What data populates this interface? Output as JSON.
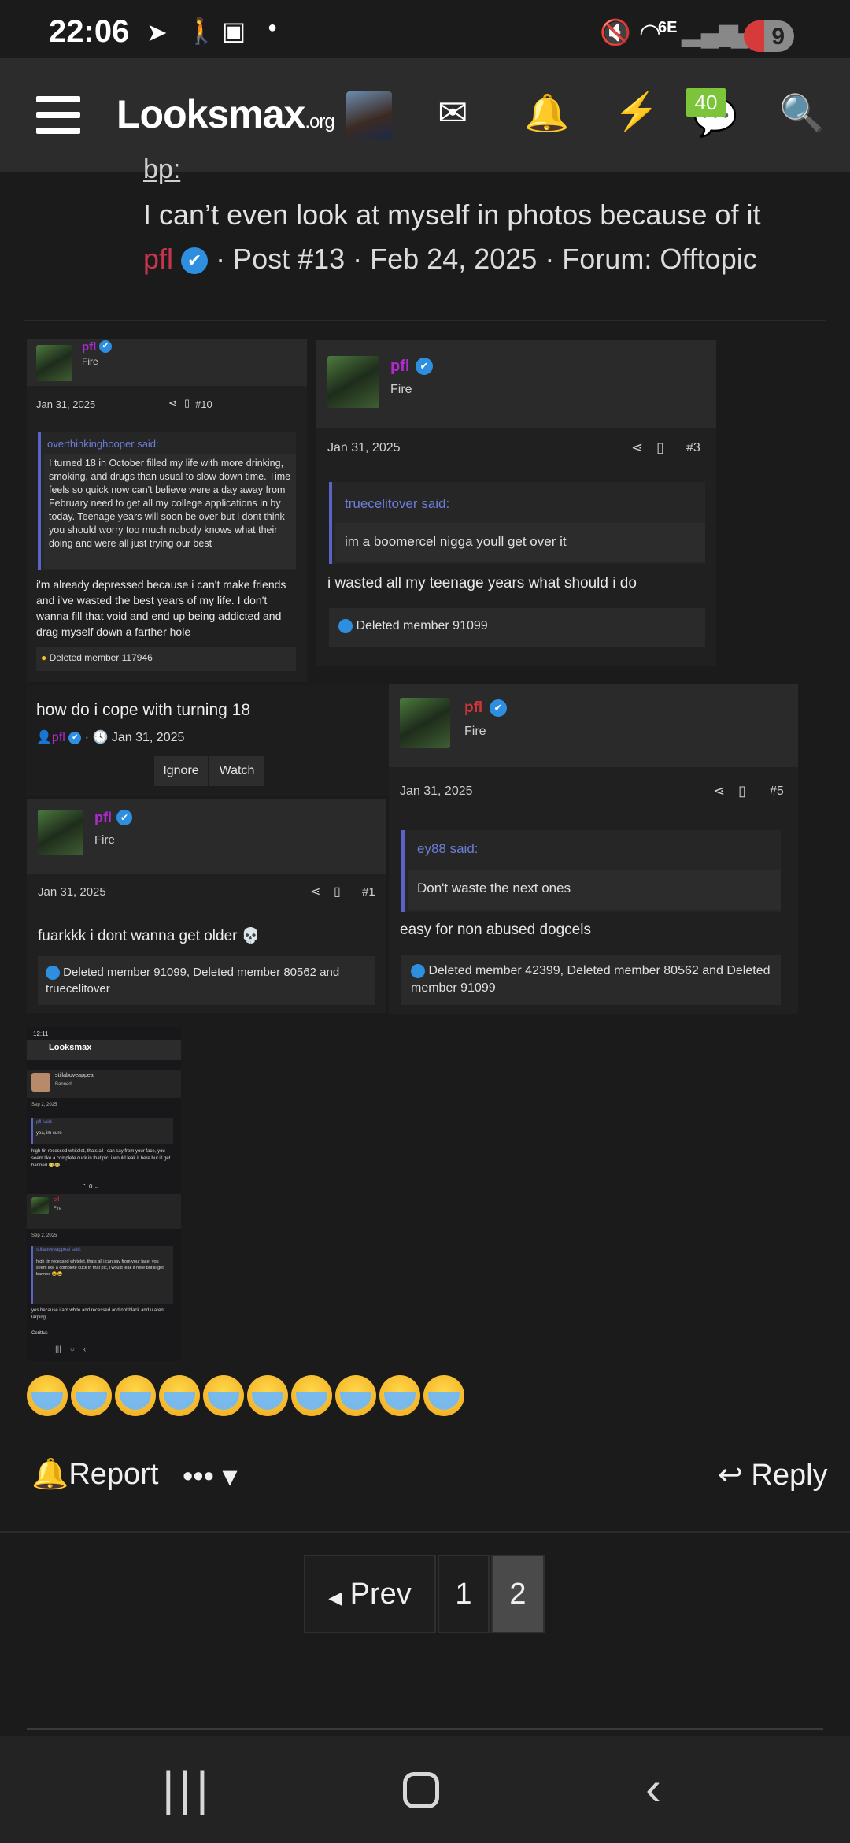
{
  "status": {
    "time": "22:06",
    "network": "6E",
    "battery": "9"
  },
  "nav": {
    "logo_main": "Looksmax",
    "logo_suffix": ".org",
    "badge_count": "40"
  },
  "post": {
    "bp_text": "bp:",
    "title": "I can’t even look at myself in photos because of it",
    "author": "pfl",
    "meta": "· Post #13 · Feb 24, 2025 · Forum: Offtopic"
  },
  "card_a": {
    "user": "pfl",
    "rank": "Fire",
    "date": "Jan 31, 2025",
    "post_no": "#10",
    "quote_author": "overthinkinghooper said:",
    "quote_body": "I turned 18 in October filled my life with more drinking, smoking, and drugs than usual to slow down time. Time feels so quick now can't believe were a day away from February need to get all my college applications in by today. Teenage years will soon be over but i dont think you should worry too much nobody knows what their doing and were all just trying our best",
    "reply": "i'm already depressed because i can't make friends and i've wasted the best years of my life. I don't wanna fill that void and end up being addicted and drag myself down a farther hole",
    "reactions": "Deleted member 117946"
  },
  "card_b": {
    "user": "pfl",
    "rank": "Fire",
    "date": "Jan 31, 2025",
    "post_no": "#3",
    "quote_author": "truecelitover said:",
    "quote_body": "im a boomercel nigga youll get over it",
    "reply": "i wasted all my teenage years what should i do",
    "reactions": "Deleted member 91099"
  },
  "thread": {
    "title": "how do i cope with turning 18",
    "author": "pfl",
    "date": "Jan 31, 2025",
    "ignore": "Ignore",
    "watch": "Watch"
  },
  "card_c": {
    "user": "pfl",
    "rank": "Fire",
    "date": "Jan 31, 2025",
    "post_no": "#1",
    "body": "fuarkkk i dont wanna get older",
    "reactions": "Deleted member 91099, Deleted member 80562 and truecelitover"
  },
  "card_d": {
    "user": "pfl",
    "rank": "Fire",
    "date": "Jan 31, 2025",
    "post_no": "#5",
    "quote_author": "ey88 said:",
    "quote_body": "Don't waste the next ones",
    "reply": "easy for non abused dogcels",
    "reactions": "Deleted member 42399, Deleted member 80562 and Deleted member 91099"
  },
  "mini": {
    "time": "12:11",
    "logo": "Looksmax",
    "user1": "stillaboveappeal",
    "rank1": "Banned",
    "date1": "Sep 2, 2025",
    "quote1_author": "pfl said:",
    "quote1_body": "yea, im sure",
    "reply1": "high tin recessed whitelet, thats all i can say from your face, you seem like a complete cuck in that pic, i would leak it here but ill get banned 😂😂",
    "votes": "0",
    "user2": "pfl",
    "rank2": "Fire",
    "date2": "Sep 2, 2025",
    "quote2_author": "stillaboveappeal said:",
    "quote2_body": "high tin recessed whitelet, thats all i can say from your face, you seem like a complete cuck in that pic, i would leak it here but ill get banned 😂😂",
    "reply2": "yes because i am white and recessed and not black and u arent larping",
    "reactions2": "Cerittus"
  },
  "emoji_count": 10,
  "actions": {
    "report": "Report",
    "reply": "Reply"
  },
  "pagination": {
    "prev": "Prev",
    "pages": [
      "1",
      "2"
    ],
    "current": "2"
  }
}
